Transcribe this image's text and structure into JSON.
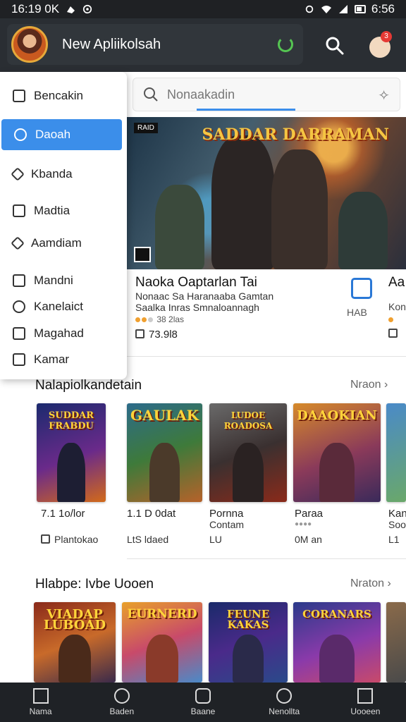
{
  "status_bar": {
    "time": "16:19 0K",
    "battery_text": "6:56"
  },
  "app_bar": {
    "title": "New Apliikolsah",
    "notification_count": "3"
  },
  "drawer": {
    "items": [
      {
        "label": "Bencakin",
        "icon": "card-icon"
      },
      {
        "label": "Daoah",
        "icon": "search-icon",
        "active": true
      },
      {
        "label": "Kbanda",
        "icon": "diamond-icon"
      },
      {
        "label": "Madtia",
        "icon": "book-icon"
      },
      {
        "label": "Aamdiam",
        "icon": "heart-icon"
      },
      {
        "label": "Mandni",
        "icon": "home-icon"
      },
      {
        "label": "Kanelaict",
        "icon": "shield-icon"
      },
      {
        "label": "Magahad",
        "icon": "photo-icon"
      },
      {
        "label": "Kamar",
        "icon": "camera-icon"
      }
    ]
  },
  "search": {
    "placeholder": "Nonaakadin"
  },
  "featured": {
    "badge": "RAID",
    "logo_text": "SADDAR DARRAMAN",
    "title": "Naoka Oaptarlan Tai",
    "description": "Nonaac Sa Haranaaba Gamtan Saalka Inras Smnaloannagh",
    "rating_text": "38 2las",
    "downloads": "73.9l8",
    "share_label": "HAB",
    "peek_title": "Aa",
    "peek_sub": "Kon"
  },
  "sections": [
    {
      "title": "Nalapiolkandetain",
      "more": "Nraon",
      "cards": [
        {
          "art_title": "SUDDAR FRABDU",
          "label": "7.1 1o/lor",
          "sub": "Plantokao"
        },
        {
          "art_title": "GAULAK",
          "label": "1.1 D 0dat",
          "sub": "LtS ldaed"
        },
        {
          "art_title": "LUDOE ROADOSA",
          "label": "Pornna",
          "sub": "Contam",
          "sub2": "LU"
        },
        {
          "art_title": "DAAOKIAN",
          "label": "Paraa",
          "sub": "0M an"
        },
        {
          "art_title": "",
          "label": "Kan",
          "sub": "Soo",
          "sub2": "L1"
        }
      ]
    },
    {
      "title": "Hlabpe: Ivbe Uooen",
      "more": "Nraton",
      "cards": [
        {
          "art_title": "VIADAP LUBOAD"
        },
        {
          "art_title": "EURNERD"
        },
        {
          "art_title": "FEUNE KAKAS"
        },
        {
          "art_title": "CORANARS"
        },
        {
          "art_title": ""
        }
      ]
    }
  ],
  "bottom_nav": [
    {
      "label": "Nama",
      "icon": "home-icon"
    },
    {
      "label": "Baden",
      "icon": "person-icon"
    },
    {
      "label": "Baane",
      "icon": "chat-icon"
    },
    {
      "label": "Nenollta",
      "icon": "compass-icon"
    },
    {
      "label": "Uooeen",
      "icon": "inbox-icon"
    }
  ],
  "colors": {
    "accent": "#3b8eea",
    "app_bar": "#2a2e33",
    "status_bar": "#1f2124",
    "bottom_nav": "#1f2226",
    "badge": "#e53935"
  }
}
